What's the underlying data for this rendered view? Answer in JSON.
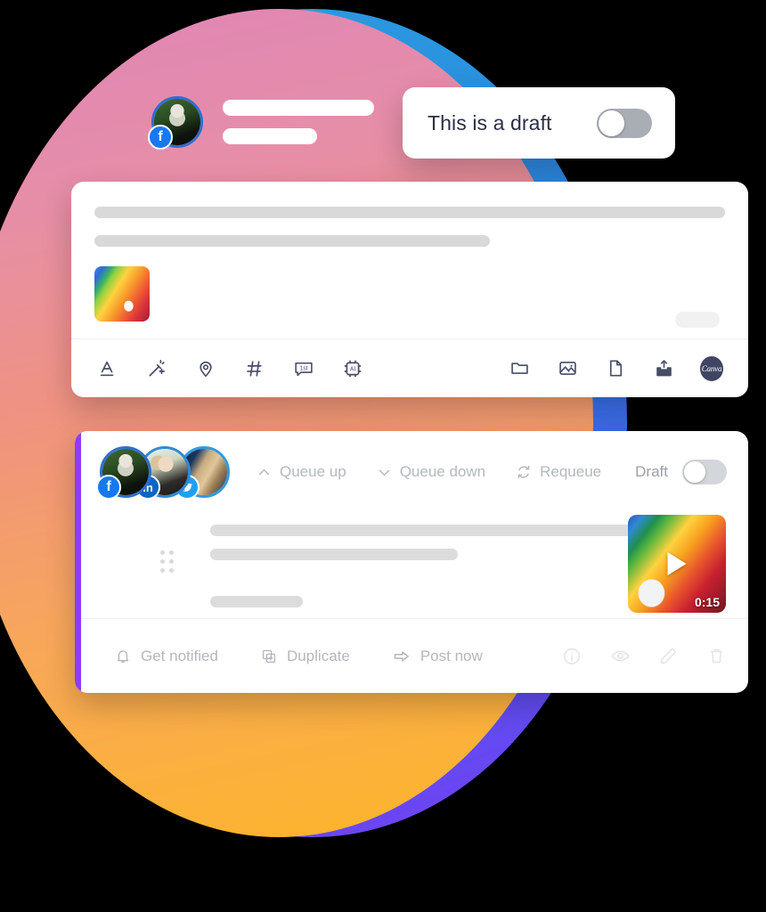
{
  "background": {
    "circle_gradient_start": "#df85b6",
    "circle_gradient_end": "#fdb525",
    "crescent_gradient_start": "#2a9fdd",
    "crescent_gradient_end": "#7a3df5",
    "backdrop": "#000000"
  },
  "draft_pill": {
    "label": "This is a draft",
    "toggle_state": "off",
    "toggle_track_color": "#a9adb4"
  },
  "profile_row": {
    "avatar_network": "facebook",
    "badge_color": "#1877f2",
    "placeholder_lines": 2
  },
  "compose_card": {
    "skeleton_lines": 2,
    "attachment": "image-thumbnail",
    "char_counter_placeholder": "",
    "toolbar_left": [
      {
        "name": "text-format-icon",
        "label": "A"
      },
      {
        "name": "magic-wand-icon",
        "label": ""
      },
      {
        "name": "location-pin-icon",
        "label": ""
      },
      {
        "name": "hashtag-icon",
        "label": ""
      },
      {
        "name": "first-comment-icon",
        "label": "1st"
      },
      {
        "name": "ai-chip-icon",
        "label": "AI"
      }
    ],
    "toolbar_right": [
      {
        "name": "folder-icon",
        "label": ""
      },
      {
        "name": "image-icon",
        "label": ""
      },
      {
        "name": "document-icon",
        "label": ""
      },
      {
        "name": "upload-icon",
        "label": ""
      },
      {
        "name": "canva-icon",
        "label": "Canva"
      }
    ]
  },
  "queue_card": {
    "accent_color": "#8b3dff",
    "avatars": [
      {
        "network": "facebook",
        "badge_color": "#1877f2",
        "glyph": "f"
      },
      {
        "network": "linkedin",
        "badge_color": "#0a66c2",
        "glyph": "in"
      },
      {
        "network": "twitter",
        "badge_color": "#1da1f2",
        "glyph": "✓"
      }
    ],
    "actions": [
      {
        "name": "queue-up",
        "label": "Queue up"
      },
      {
        "name": "queue-down",
        "label": "Queue down"
      },
      {
        "name": "requeue",
        "label": "Requeue"
      }
    ],
    "draft_label": "Draft",
    "draft_toggle_state": "off",
    "skeleton_lines": 3,
    "video": {
      "duration": "0:15",
      "has_play_button": true
    },
    "footer_actions": [
      {
        "name": "get-notified",
        "label": "Get notified"
      },
      {
        "name": "duplicate",
        "label": "Duplicate"
      },
      {
        "name": "post-now",
        "label": "Post now"
      }
    ],
    "footer_icons": [
      {
        "name": "info-icon"
      },
      {
        "name": "preview-eye-icon"
      },
      {
        "name": "edit-pencil-icon"
      },
      {
        "name": "delete-trash-icon"
      }
    ]
  }
}
